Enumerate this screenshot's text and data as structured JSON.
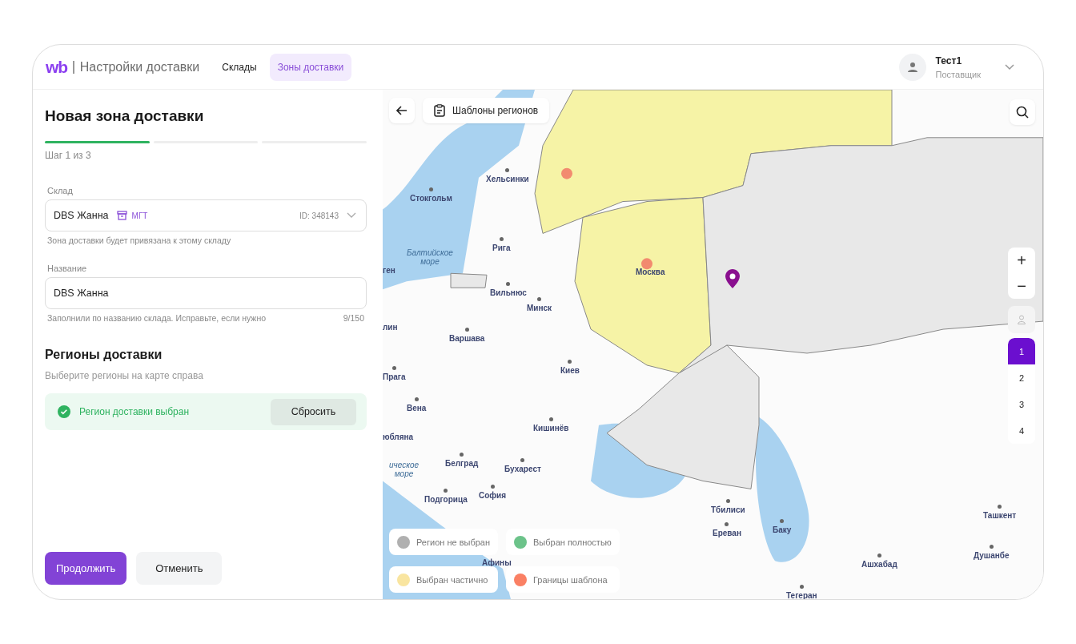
{
  "header": {
    "logo": "wb",
    "title": "Настройки доставки",
    "nav": [
      {
        "label": "Склады",
        "selected": false
      },
      {
        "label": "Зоны доставки",
        "selected": true
      }
    ],
    "user": {
      "name": "Тест1",
      "role": "Поставщик"
    }
  },
  "form": {
    "title": "Новая зона доставки",
    "steps": [
      {
        "done": true
      },
      {
        "done": false
      },
      {
        "done": false
      }
    ],
    "step_label": "Шаг 1 из 3",
    "warehouse": {
      "label": "Склад",
      "value": "DBS Жанна",
      "badge": "МГТ",
      "id": "ID: 348143",
      "hint": "Зона доставки будет привязана к этому складу"
    },
    "name": {
      "label": "Название",
      "value": "DBS Жанна",
      "hint": "Заполнили по названию склада. Исправьте, если нужно",
      "counter": "9/150"
    },
    "regions": {
      "title": "Регионы доставки",
      "subtitle": "Выберите регионы на карте справа",
      "status": "Регион доставки выбран",
      "reset": "Сбросить"
    },
    "actions": [
      {
        "label": "Продолжить",
        "kind": "primary"
      },
      {
        "label": "Отменить",
        "kind": "secondary"
      }
    ]
  },
  "map": {
    "templates": "Шаблоны регионов",
    "zoom": [
      "+",
      "−"
    ],
    "floors": [
      {
        "label": "1",
        "selected": true
      },
      {
        "label": "2",
        "selected": false
      },
      {
        "label": "3",
        "selected": false
      },
      {
        "label": "4",
        "selected": false
      }
    ],
    "cities": [
      {
        "name": "Хельсинки",
        "kind": "city"
      },
      {
        "name": "Стокгольм",
        "kind": "city"
      },
      {
        "name": "Рига",
        "kind": "city"
      },
      {
        "name": "Балтийское море",
        "kind": "sea"
      },
      {
        "name": "ген",
        "kind": "label"
      },
      {
        "name": "Вильнюс",
        "kind": "city"
      },
      {
        "name": "Минск",
        "kind": "city"
      },
      {
        "name": "Москва",
        "kind": "label"
      },
      {
        "name": "лин",
        "kind": "label"
      },
      {
        "name": "Варшава",
        "kind": "city"
      },
      {
        "name": "Прага",
        "kind": "city"
      },
      {
        "name": "Киев",
        "kind": "city"
      },
      {
        "name": "Вена",
        "kind": "city"
      },
      {
        "name": "Кишинёв",
        "kind": "city"
      },
      {
        "name": "юбляна",
        "kind": "label"
      },
      {
        "name": "ическое море",
        "kind": "sea"
      },
      {
        "name": "Белград",
        "kind": "city"
      },
      {
        "name": "Бухарест",
        "kind": "city"
      },
      {
        "name": "София",
        "kind": "city"
      },
      {
        "name": "Подгорица",
        "kind": "city"
      },
      {
        "name": "Афины",
        "kind": "label"
      },
      {
        "name": "Тбилиси",
        "kind": "city"
      },
      {
        "name": "Ереван",
        "kind": "city"
      },
      {
        "name": "Баку",
        "kind": "city"
      },
      {
        "name": "Ташкент",
        "kind": "city"
      },
      {
        "name": "Душанбе",
        "kind": "city"
      },
      {
        "name": "Ашхабад",
        "kind": "city"
      },
      {
        "name": "Тегеран",
        "kind": "city"
      }
    ],
    "legend": [
      {
        "label": "Регион не выбран",
        "color": "#b0b0b0"
      },
      {
        "label": "Выбран полностью",
        "color": "#6cc38a"
      },
      {
        "label": "Выбран частично",
        "color": "#f9e5a0"
      },
      {
        "label": "Границы шаблона",
        "color": "#fa8064"
      }
    ]
  }
}
